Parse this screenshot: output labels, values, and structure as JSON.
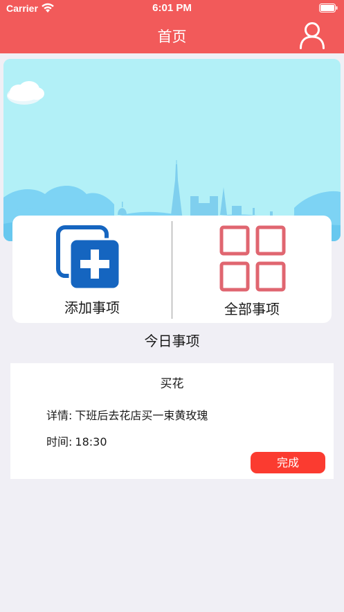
{
  "status_bar": {
    "carrier": "Carrier",
    "time": "6:01 PM"
  },
  "nav": {
    "title": "首页",
    "right_icon": "user-icon"
  },
  "colors": {
    "header": "#f25a5a",
    "done_button": "#fb3b30",
    "add_icon": "#1565c0",
    "grid_icon": "#e06670",
    "banner_sky": "#b2f0f7"
  },
  "actions": {
    "add_label": "添加事项",
    "all_label": "全部事项"
  },
  "today": {
    "title": "今日事项"
  },
  "task": {
    "title": "买花",
    "detail_label": "详情:",
    "detail_value": "下班后去花店买一束黄玫瑰",
    "time_label": "时间:",
    "time_value": "18:30",
    "done_label": "完成"
  }
}
